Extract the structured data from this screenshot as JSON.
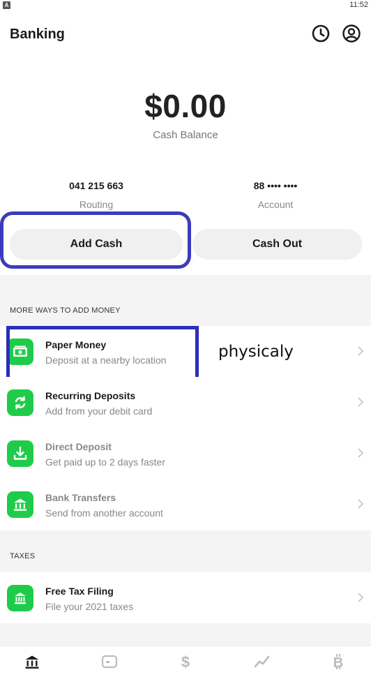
{
  "status_bar": {
    "app_badge": "A",
    "time": "11:52"
  },
  "header": {
    "title": "Banking"
  },
  "balance": {
    "amount": "$0.00",
    "label": "Cash Balance"
  },
  "routing": {
    "number": "041 215 663",
    "label": "Routing"
  },
  "account": {
    "number": "88 •••• ••••",
    "label": "Account"
  },
  "actions": {
    "add_cash": "Add Cash",
    "cash_out": "Cash Out"
  },
  "sections": {
    "more_ways": {
      "title": "MORE WAYS TO ADD MONEY",
      "items": [
        {
          "title": "Paper Money",
          "subtitle": "Deposit at a nearby location",
          "icon": "cash-icon"
        },
        {
          "title": "Recurring Deposits",
          "subtitle": "Add from your debit card",
          "icon": "recurring-icon"
        },
        {
          "title": "Direct Deposit",
          "subtitle": "Get paid up to 2 days faster",
          "icon": "download-icon"
        },
        {
          "title": "Bank Transfers",
          "subtitle": "Send from another account",
          "icon": "bank-icon"
        }
      ]
    },
    "taxes": {
      "title": "TAXES",
      "items": [
        {
          "title": "Free Tax Filing",
          "subtitle": "File your 2021 taxes",
          "icon": "tax-building-icon"
        }
      ]
    }
  },
  "annotation": {
    "text": "physicaly"
  },
  "bottom_nav": [
    "banking-icon",
    "card-icon",
    "dollar-icon",
    "investing-icon",
    "bitcoin-icon"
  ],
  "colors": {
    "accent_green": "#1fcc4a",
    "annotation_blue": "#3b3bbf"
  }
}
